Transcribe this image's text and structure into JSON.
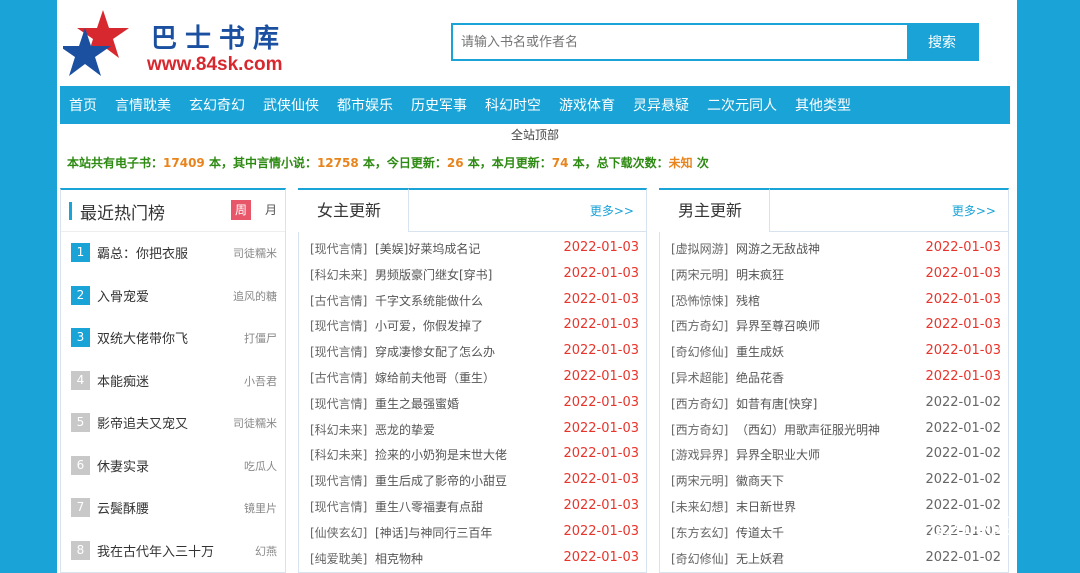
{
  "site": {
    "logo_title": "巴士书库",
    "logo_url": "www.84sk.com"
  },
  "search": {
    "placeholder": "请输入书名或作者名",
    "button": "搜索"
  },
  "nav": [
    "首页",
    "言情耽美",
    "玄幻奇幻",
    "武侠仙侠",
    "都市娱乐",
    "历史军事",
    "科幻时空",
    "游戏体育",
    "灵异悬疑",
    "二次元同人",
    "其他类型"
  ],
  "breadcrumb": "全站顶部",
  "stats": {
    "t1": "本站共有电子书：",
    "total": "17409",
    "t2": " 本，其中言情小说：",
    "romance": "12758",
    "t3": " 本，今日更新：",
    "today": "26",
    "t4": " 本，本月更新：",
    "month": "74",
    "t5": " 本，总下载次数：",
    "downloads": "未知",
    "t6": " 次"
  },
  "hot": {
    "title": "最近热门榜",
    "tab_week": "周",
    "tab_month": "月",
    "items": [
      {
        "rank": "1",
        "book": "霸总：你把衣服",
        "author": "司徒糯米"
      },
      {
        "rank": "2",
        "book": "入骨宠爱",
        "author": "追风的糖"
      },
      {
        "rank": "3",
        "book": "双统大佬带你飞",
        "author": "打僵尸"
      },
      {
        "rank": "4",
        "book": "本能痴迷",
        "author": "小吾君"
      },
      {
        "rank": "5",
        "book": "影帝追夫又宠又",
        "author": "司徒糯米"
      },
      {
        "rank": "6",
        "book": "休妻实录",
        "author": "吃瓜人"
      },
      {
        "rank": "7",
        "book": "云鬓酥腰",
        "author": "镜里片"
      },
      {
        "rank": "8",
        "book": "我在古代年入三十万",
        "author": "幻燕"
      }
    ]
  },
  "female": {
    "title": "女主更新",
    "more": "更多>>",
    "items": [
      {
        "cat": "[现代言情]",
        "book": "[美娱]好莱坞成名记",
        "date": "2022-01-03"
      },
      {
        "cat": "[科幻未来]",
        "book": "男频版豪门继女[穿书]",
        "date": "2022-01-03"
      },
      {
        "cat": "[古代言情]",
        "book": "千字文系统能做什么",
        "date": "2022-01-03"
      },
      {
        "cat": "[现代言情]",
        "book": "小可爱，你假发掉了",
        "date": "2022-01-03"
      },
      {
        "cat": "[现代言情]",
        "book": "穿成凄惨女配了怎么办",
        "date": "2022-01-03"
      },
      {
        "cat": "[古代言情]",
        "book": "嫁给前夫他哥（重生）",
        "date": "2022-01-03"
      },
      {
        "cat": "[现代言情]",
        "book": "重生之最强蜜婚",
        "date": "2022-01-03"
      },
      {
        "cat": "[科幻未来]",
        "book": "恶龙的挚爱",
        "date": "2022-01-03"
      },
      {
        "cat": "[科幻未来]",
        "book": "捡来的小奶狗是末世大佬",
        "date": "2022-01-03"
      },
      {
        "cat": "[现代言情]",
        "book": "重生后成了影帝的小甜豆",
        "date": "2022-01-03"
      },
      {
        "cat": "[现代言情]",
        "book": "重生八零福妻有点甜",
        "date": "2022-01-03"
      },
      {
        "cat": "[仙侠玄幻]",
        "book": "[神话]与神同行三百年",
        "date": "2022-01-03"
      },
      {
        "cat": "[纯爱耽美]",
        "book": "相克物种",
        "date": "2022-01-03"
      }
    ]
  },
  "male": {
    "title": "男主更新",
    "more": "更多>>",
    "items": [
      {
        "cat": "[虚拟网游]",
        "book": "网游之无敌战神",
        "date": "2022-01-03",
        "new": true
      },
      {
        "cat": "[两宋元明]",
        "book": "明末疯狂",
        "date": "2022-01-03",
        "new": true
      },
      {
        "cat": "[恐怖惊悚]",
        "book": "残棺",
        "date": "2022-01-03",
        "new": true
      },
      {
        "cat": "[西方奇幻]",
        "book": "异界至尊召唤师",
        "date": "2022-01-03",
        "new": true
      },
      {
        "cat": "[奇幻修仙]",
        "book": "重生成妖",
        "date": "2022-01-03",
        "new": true
      },
      {
        "cat": "[异术超能]",
        "book": "绝品花香",
        "date": "2022-01-03",
        "new": true
      },
      {
        "cat": "[西方奇幻]",
        "book": "如昔有唐[快穿]",
        "date": "2022-01-02",
        "new": false
      },
      {
        "cat": "[西方奇幻]",
        "book": "（西幻）用歌声征服光明神",
        "date": "2022-01-02",
        "new": false
      },
      {
        "cat": "[游戏异界]",
        "book": "异界全职业大师",
        "date": "2022-01-02",
        "new": false
      },
      {
        "cat": "[两宋元明]",
        "book": "徽商天下",
        "date": "2022-01-02",
        "new": false
      },
      {
        "cat": "[未来幻想]",
        "book": "末日新世界",
        "date": "2022-01-02",
        "new": false
      },
      {
        "cat": "[东方玄幻]",
        "book": "传道太千",
        "date": "2022-01-02",
        "new": false
      },
      {
        "cat": "[奇幻修仙]",
        "book": "无上妖君",
        "date": "2022-01-02",
        "new": false
      }
    ]
  },
  "watermark": "爱搜互联网",
  "colors": {
    "accent": "#1aa3d6",
    "date_new": "#e8342b",
    "stats_green": "#2d8a12",
    "stats_orange": "#e8841c"
  }
}
